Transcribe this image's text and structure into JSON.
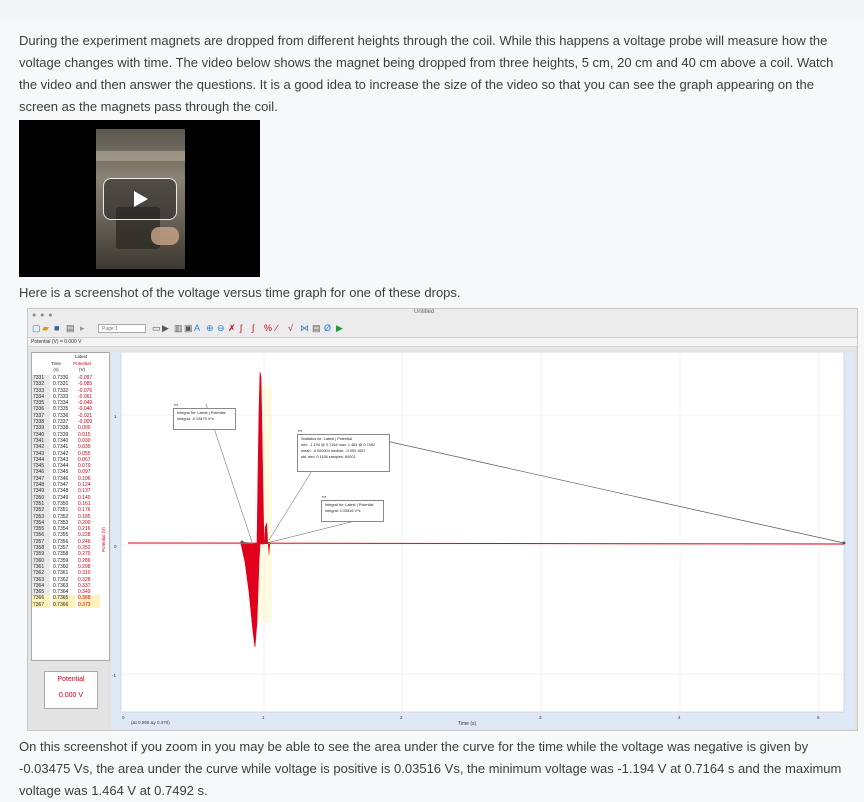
{
  "paragraphs": {
    "intro": "During the experiment magnets are dropped from different heights through the coil. While this happens a voltage probe will measure how the voltage changes with time. The video below shows the magnet being dropped from three heights, 5 cm, 20 cm and 40 cm above a coil. Watch the video and then answer the questions. It is a good idea to increase the size of the video so that you can see the graph appearing on the screen as the magnets pass through the coil.",
    "screenshot_intro": "Here is a screenshot of the voltage versus time graph for one of these drops.",
    "summary": "On this screenshot if you zoom in you may be able to see the area under the curve for the time while the voltage was negative is given by -0.03475 Vs, the area under the curve while voltage is positive is 0.03516 Vs, the minimum voltage was -1.194 V at 0.7164 s and the maximum voltage was 1.464 V at 0.7492 s."
  },
  "video": {
    "play_icon": "play-icon"
  },
  "logger_app": {
    "window_title": "Untitled",
    "page_select": "Page 1",
    "meter_readout": "Potential (V) = 0.000 V",
    "table": {
      "group_label": "Latest",
      "columns": [
        "Time",
        "Potential"
      ],
      "units": [
        "(s)",
        "(V)"
      ],
      "rows": [
        {
          "i": "7331",
          "t": "0.7330",
          "v": "-0.097"
        },
        {
          "i": "7332",
          "t": "0.7331",
          "v": "-0.085"
        },
        {
          "i": "7333",
          "t": "0.7332",
          "v": "-0.076"
        },
        {
          "i": "7334",
          "t": "0.7333",
          "v": "-0.061"
        },
        {
          "i": "7335",
          "t": "0.7334",
          "v": "-0.049"
        },
        {
          "i": "7336",
          "t": "0.7335",
          "v": "-0.040"
        },
        {
          "i": "7337",
          "t": "0.7336",
          "v": "-0.021"
        },
        {
          "i": "7338",
          "t": "0.7337",
          "v": "-0.009"
        },
        {
          "i": "7339",
          "t": "0.7338",
          "v": "0.000"
        },
        {
          "i": "7340",
          "t": "0.7339",
          "v": "0.015"
        },
        {
          "i": "7341",
          "t": "0.7340",
          "v": "0.030"
        },
        {
          "i": "7342",
          "t": "0.7341",
          "v": "0.039"
        },
        {
          "i": "7343",
          "t": "0.7342",
          "v": "0.055"
        },
        {
          "i": "7344",
          "t": "0.7343",
          "v": "0.067"
        },
        {
          "i": "7345",
          "t": "0.7344",
          "v": "0.079"
        },
        {
          "i": "7346",
          "t": "0.7345",
          "v": "0.097"
        },
        {
          "i": "7347",
          "t": "0.7346",
          "v": "0.106"
        },
        {
          "i": "7348",
          "t": "0.7347",
          "v": "0.124"
        },
        {
          "i": "7349",
          "t": "0.7348",
          "v": "0.137"
        },
        {
          "i": "7350",
          "t": "0.7349",
          "v": "0.149"
        },
        {
          "i": "7351",
          "t": "0.7350",
          "v": "0.161"
        },
        {
          "i": "7352",
          "t": "0.7351",
          "v": "0.176"
        },
        {
          "i": "7353",
          "t": "0.7352",
          "v": "0.185"
        },
        {
          "i": "7354",
          "t": "0.7353",
          "v": "0.200"
        },
        {
          "i": "7355",
          "t": "0.7354",
          "v": "0.216"
        },
        {
          "i": "7356",
          "t": "0.7355",
          "v": "0.228"
        },
        {
          "i": "7357",
          "t": "0.7356",
          "v": "0.246"
        },
        {
          "i": "7358",
          "t": "0.7357",
          "v": "0.252"
        },
        {
          "i": "7359",
          "t": "0.7358",
          "v": "0.270"
        },
        {
          "i": "7360",
          "t": "0.7359",
          "v": "0.286"
        },
        {
          "i": "7361",
          "t": "0.7360",
          "v": "0.298"
        },
        {
          "i": "7362",
          "t": "0.7361",
          "v": "0.310"
        },
        {
          "i": "7363",
          "t": "0.7362",
          "v": "0.328"
        },
        {
          "i": "7364",
          "t": "0.7363",
          "v": "0.337"
        },
        {
          "i": "7365",
          "t": "0.7364",
          "v": "0.349"
        },
        {
          "i": "7366",
          "t": "0.7365",
          "v": "0.368"
        },
        {
          "i": "7367",
          "t": "0.7366",
          "v": "0.373"
        }
      ]
    },
    "potential_panel": {
      "label": "Potential",
      "value": "0.000 V"
    },
    "graph": {
      "x_axis_label": "Time (s)",
      "y_axis_label": "Potential (V)",
      "x_ticks": [
        "0",
        "1",
        "2",
        "3",
        "4",
        "5"
      ],
      "y_ticks": [
        "1",
        "0",
        "-1"
      ],
      "coord_readout": "(Δt 0.090 Δy 0.370)",
      "annotations": {
        "integral_neg": {
          "line1": "Integral for: Latest | Potential",
          "line2": "Integral: -0.03475 V*s"
        },
        "statistics": {
          "line1": "Statistics for: Latest | Potential",
          "line2": "min: -1.194 @ 0.7164   max: 1.464 @ 0.7492",
          "line3": "mean: -0.000004   median: -0.000 1657",
          "line4": "std. dev: 0.1156   samples: 80001"
        },
        "integral_pos": {
          "line1": "Integral for: Latest | Potential",
          "line2": "Integral: 0.03516 V*s"
        }
      },
      "trace_color": "#e0001b"
    }
  }
}
